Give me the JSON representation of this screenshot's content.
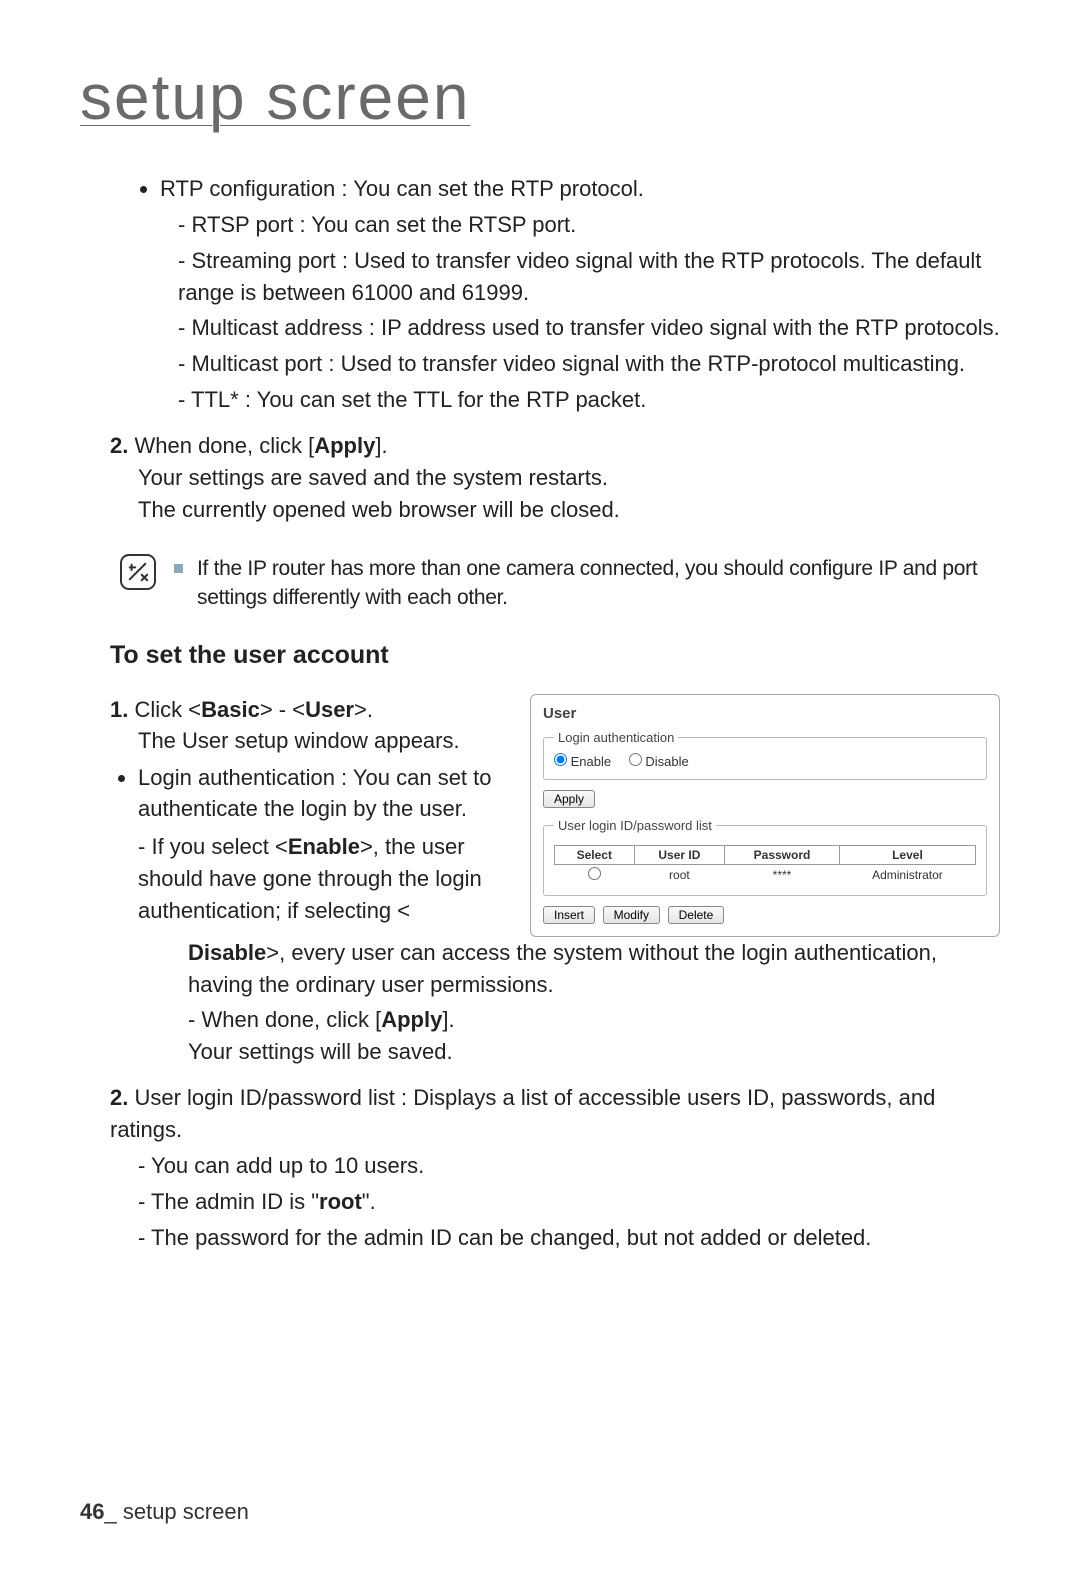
{
  "page_title": "setup screen",
  "rtp": {
    "intro": "RTP configuration : You can set the RTP protocol.",
    "items": [
      "RTSP port : You can set the RTSP port.",
      "Streaming port : Used to transfer video signal with the RTP protocols. The default range is between 61000 and 61999.",
      "Multicast address : IP address used to transfer video signal with the RTP protocols.",
      "Multicast port : Used to transfer video signal with the RTP-protocol multicasting.",
      "TTL* : You can set the TTL for the RTP packet."
    ]
  },
  "step2": {
    "num": "2.",
    "line1_a": "When done, click [",
    "line1_b": "Apply",
    "line1_c": "].",
    "line2": "Your settings are saved and the system restarts.",
    "line3": "The currently opened web browser will be closed."
  },
  "note": "If the IP router has more than one camera connected, you should configure IP and port settings differently with each other.",
  "section_heading": "To set the user account",
  "ua_step1": {
    "num": "1.",
    "a": "Click <",
    "basic": "Basic",
    "b": "> - <",
    "user": "User",
    "c": ">.",
    "sub": "The User setup window appears.",
    "bullet": "Login authentication : You can set to authenticate the login by the user.",
    "d1_a": "If you select <",
    "d1_enable": "Enable",
    "d1_b": ">, the user should have gone through the login authentication; if selecting <",
    "d1_disable": "Disable",
    "d1_c": ">, every user can access the system without the login authentication, having the ordinary user permissions.",
    "d2_a": "When done, click [",
    "d2_apply": "Apply",
    "d2_b": "].",
    "d2_sub": "Your settings will be saved."
  },
  "ua_step2": {
    "num": "2.",
    "intro": "User login ID/password list : Displays a list of accessible users ID, passwords, and ratings.",
    "d1": "You can add up to 10 users.",
    "d2_a": "The admin ID is \"",
    "d2_root": "root",
    "d2_b": "\".",
    "d3": "The password for the admin ID can be changed, but not added or deleted."
  },
  "panel": {
    "title": "User",
    "fs1_legend": "Login authentication",
    "enable": "Enable",
    "disable": "Disable",
    "apply": "Apply",
    "fs2_legend": "User login ID/password list",
    "th_select": "Select",
    "th_user": "User ID",
    "th_pass": "Password",
    "th_level": "Level",
    "row_user": "root",
    "row_pass": "****",
    "row_level": "Administrator",
    "insert": "Insert",
    "modify": "Modify",
    "delete": "Delete"
  },
  "footer": {
    "page": "46",
    "sep": "_ ",
    "label": "setup screen"
  }
}
